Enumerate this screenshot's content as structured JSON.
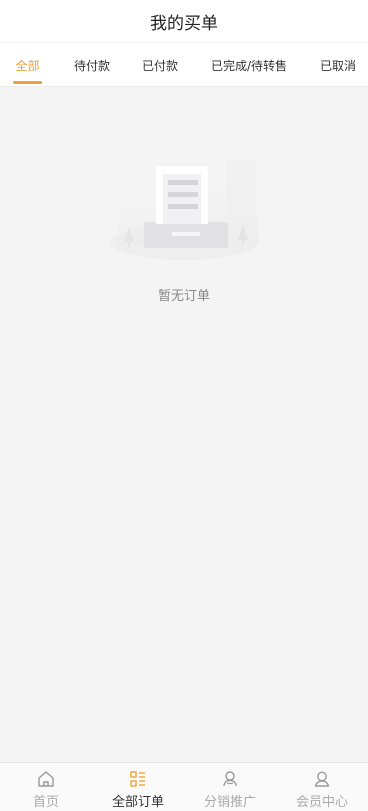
{
  "header": {
    "title": "我的买单"
  },
  "tabs": [
    {
      "label": "全部",
      "active": true
    },
    {
      "label": "待付款",
      "active": false
    },
    {
      "label": "已付款",
      "active": false
    },
    {
      "label": "已完成/待转售",
      "active": false
    },
    {
      "label": "已取消",
      "active": false
    }
  ],
  "empty_state": {
    "text": "暂无订单",
    "icon": "empty-order-illustration"
  },
  "bottom_nav": [
    {
      "label": "首页",
      "icon": "home-icon",
      "active": false
    },
    {
      "label": "全部订单",
      "icon": "order-list-icon",
      "active": true
    },
    {
      "label": "分销推广",
      "icon": "promote-user-icon",
      "active": false
    },
    {
      "label": "会员中心",
      "icon": "member-user-icon",
      "active": false
    }
  ],
  "colors": {
    "accent": "#f2a233",
    "background": "#f4f4f4",
    "inactive_text": "#aaaaaa"
  }
}
